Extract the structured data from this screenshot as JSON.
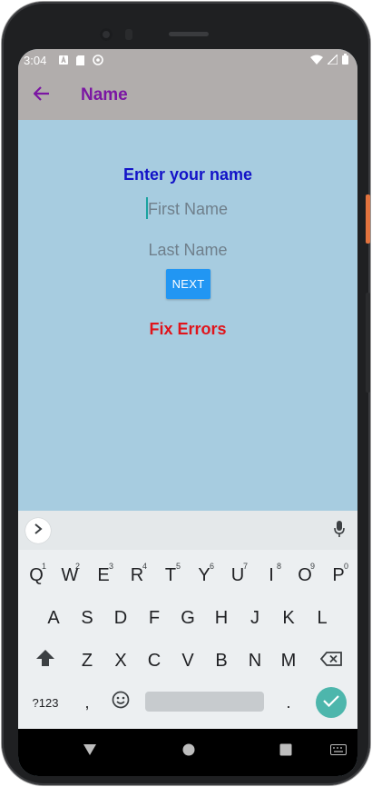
{
  "status_bar": {
    "time": "3:04",
    "icons": [
      "a-box-icon",
      "sd-card-icon",
      "sync-circle-icon",
      "wifi-icon",
      "signal-icon",
      "battery-icon"
    ]
  },
  "app_bar": {
    "title": "Name",
    "back_icon": "arrow-left-icon"
  },
  "form": {
    "heading": "Enter your name",
    "first_name_placeholder": "First Name",
    "last_name_placeholder": "Last Name",
    "next_label": "NEXT",
    "error_text": "Fix Errors"
  },
  "keyboard": {
    "row1": [
      {
        "key": "Q",
        "hint": "1"
      },
      {
        "key": "W",
        "hint": "2"
      },
      {
        "key": "E",
        "hint": "3"
      },
      {
        "key": "R",
        "hint": "4"
      },
      {
        "key": "T",
        "hint": "5"
      },
      {
        "key": "Y",
        "hint": "6"
      },
      {
        "key": "U",
        "hint": "7"
      },
      {
        "key": "I",
        "hint": "8"
      },
      {
        "key": "O",
        "hint": "9"
      },
      {
        "key": "P",
        "hint": "0"
      }
    ],
    "row2": [
      "A",
      "S",
      "D",
      "F",
      "G",
      "H",
      "J",
      "K",
      "L"
    ],
    "row3": [
      "Z",
      "X",
      "C",
      "V",
      "B",
      "N",
      "M"
    ],
    "symbols_label": "?123",
    "comma_label": ",",
    "period_label": "."
  },
  "colors": {
    "background": "#a7cce0",
    "app_bar": "#b1adac",
    "title": "#7b16a3",
    "heading": "#1313c8",
    "button": "#2196f3",
    "error": "#e0141b",
    "enter_key": "#4db6ac"
  }
}
